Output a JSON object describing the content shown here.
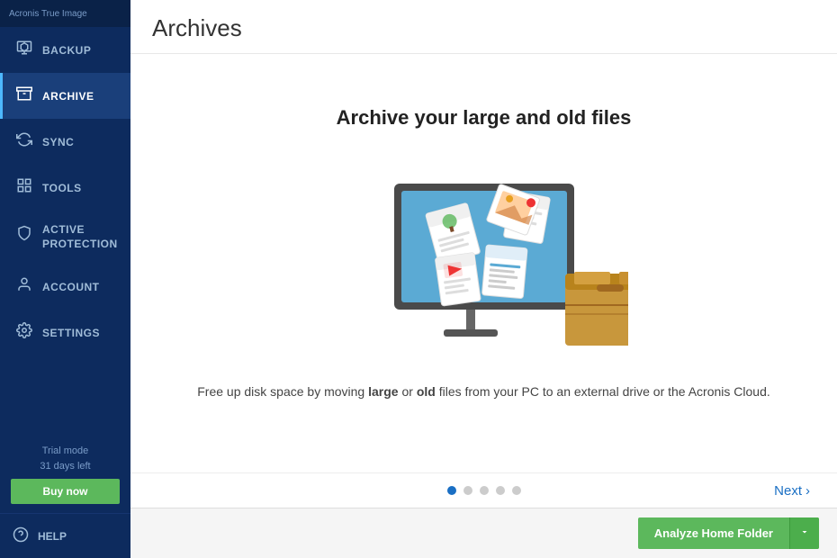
{
  "sidebar": {
    "logo_text": "Acronis True Image",
    "items": [
      {
        "id": "backup",
        "label": "BACKUP",
        "icon": "💾",
        "active": false
      },
      {
        "id": "archive",
        "label": "ARCHIVE",
        "icon": "🗂",
        "active": true
      },
      {
        "id": "sync",
        "label": "SYNC",
        "icon": "🔄",
        "active": false
      },
      {
        "id": "tools",
        "label": "TOOLS",
        "icon": "⊞",
        "active": false
      },
      {
        "id": "active-protection",
        "label": "ACTIVE\nPROTECTION",
        "icon": "🛡",
        "active": false
      },
      {
        "id": "account",
        "label": "ACCOUNT",
        "icon": "👤",
        "active": false
      },
      {
        "id": "settings",
        "label": "SETTINGS",
        "icon": "⚙",
        "active": false
      }
    ],
    "trial_mode_label": "Trial mode",
    "trial_days_label": "31 days left",
    "buy_now_label": "Buy now",
    "help_label": "HELP"
  },
  "header": {
    "title": "Archives"
  },
  "main": {
    "archive_heading": "Archive your large and old files",
    "description": "Free up disk space by moving large or old files from your PC to an external drive or the Acronis Cloud.",
    "description_bold_words": [
      "large",
      "old"
    ],
    "dots": [
      {
        "active": true
      },
      {
        "active": false
      },
      {
        "active": false
      },
      {
        "active": false
      },
      {
        "active": false
      }
    ],
    "next_label": "Next",
    "analyze_btn_label": "Analyze Home Folder"
  }
}
